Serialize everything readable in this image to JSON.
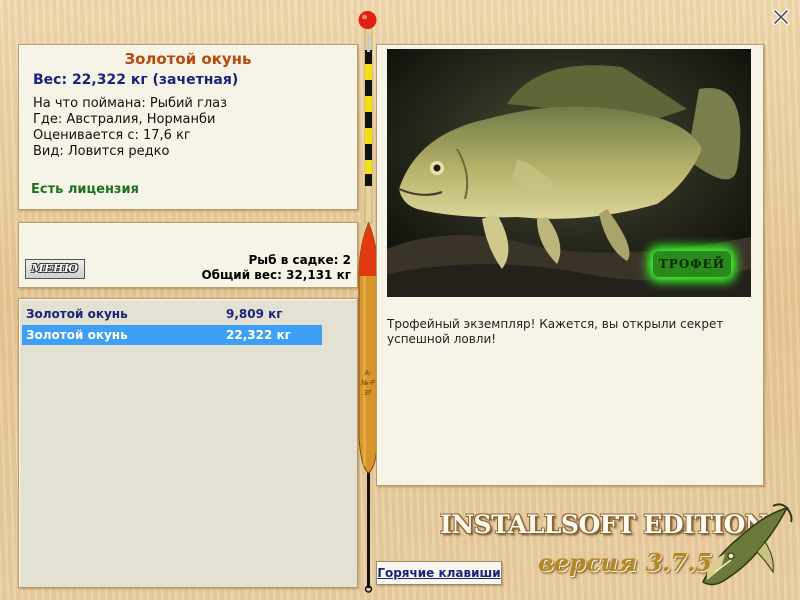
{
  "info": {
    "title": "Золотой окунь",
    "weight": "Вес: 22,322 кг (зачетная)",
    "bait": "На что поймана: Рыбий глаз",
    "location": "Где: Австралия, Норманби",
    "threshold": "Оценивается с: 17,6 кг",
    "rarity": "Вид: Ловится редко",
    "license": "Есть лицензия"
  },
  "cage": {
    "menu_label": "МЕНЮ",
    "count": "Рыб в садке: 2",
    "total_weight": "Общий вес: 32,131 кг"
  },
  "catch_list": [
    {
      "name": "Золотой окунь",
      "weight": "9,809 кг"
    },
    {
      "name": "Золотой окунь",
      "weight": "22,322 кг"
    }
  ],
  "trophy": {
    "badge": "ТРОФЕЙ",
    "message": "Трофейный экземпляр! Кажется, вы открыли секрет успешной ловли!"
  },
  "float_marking": "А-№-Р 3Г",
  "footer": {
    "hotkeys_label": "Горячие клавиши",
    "edition": "INSTALLSOFT EDITION",
    "version": "версия 3.7.5"
  },
  "colors": {
    "title": "#b8480e",
    "weight": "#1a237e",
    "license": "#1f6f1f",
    "selected_row": "#3d9ff5",
    "trophy_glow": "#3cff2c"
  },
  "icons": [
    "close-icon",
    "fishing-float-icon",
    "pike-logo-icon"
  ]
}
